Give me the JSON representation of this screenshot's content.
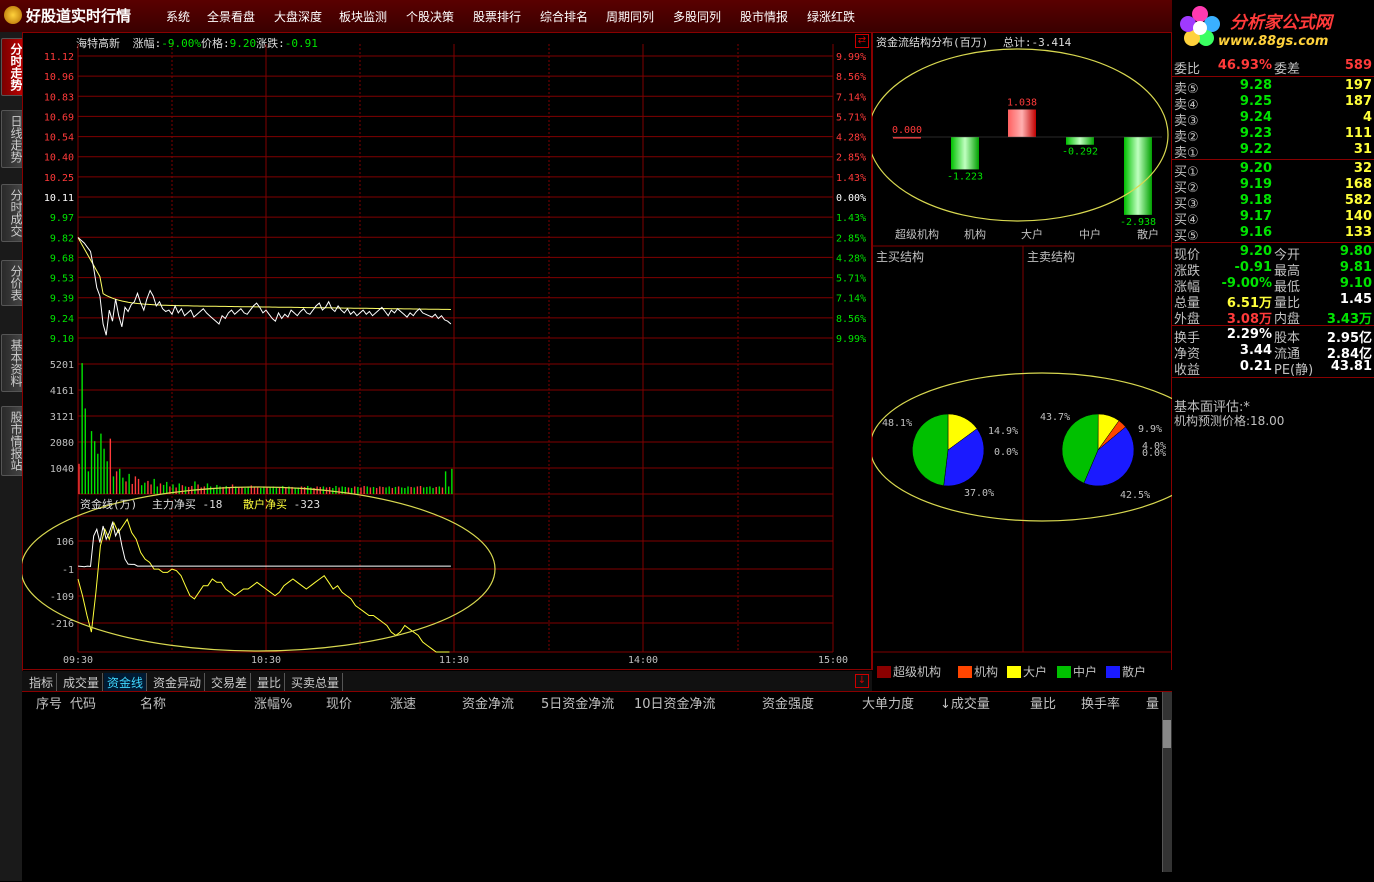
{
  "app": {
    "title": "好股道实时行情"
  },
  "menu": [
    "系统",
    "全景看盘",
    "大盘深度",
    "板块监测",
    "个股决策",
    "股票排行",
    "综合排名",
    "周期同列",
    "多股同列",
    "股市情报",
    "绿涨红跌"
  ],
  "brand": {
    "title": "分析家公式网",
    "url": "www.88gs.com"
  },
  "left_tabs": [
    "分时走势",
    "日线走势",
    "分时成交",
    "分价表",
    "基本资料",
    "股市情报站"
  ],
  "stock_header": {
    "name": "海特高新",
    "change_pct_label": "涨幅:",
    "change_pct": "-9.00%",
    "price_label": "价格:",
    "price": "9.20",
    "change_label": "涨跌:",
    "change": "-0.91"
  },
  "price_axis": {
    "left": [
      "11.12",
      "10.96",
      "10.83",
      "10.69",
      "10.54",
      "10.40",
      "10.25",
      "10.11",
      "9.97",
      "9.82",
      "9.68",
      "9.53",
      "9.39",
      "9.24",
      "9.10"
    ],
    "right": [
      "9.99%",
      "8.56%",
      "7.14%",
      "5.71%",
      "4.28%",
      "2.85%",
      "1.43%",
      "0.00%",
      "1.43%",
      "2.85%",
      "4.28%",
      "5.71%",
      "7.14%",
      "8.56%",
      "9.99%"
    ]
  },
  "volume_axis": [
    "5201",
    "4161",
    "3121",
    "2080",
    "1040"
  ],
  "fund_header": {
    "title": "资金线(万)",
    "main_label": "主力净买",
    "main_value": "-18",
    "retail_label": "散户净买",
    "retail_value": "-323"
  },
  "fund_axis": [
    "106",
    "-1",
    "-109",
    "-216"
  ],
  "time_axis": [
    "09:30",
    "10:30",
    "11:30",
    "14:00",
    "15:00"
  ],
  "bottom_tabs": [
    "指标",
    "成交量",
    "资金线",
    "资金异动",
    "交易差",
    "量比",
    "买卖总量"
  ],
  "bottom_tab_active": "资金线",
  "table_headers": [
    "序号",
    "代码",
    "名称",
    "涨幅%",
    "现价",
    "涨速",
    "资金净流",
    "5日资金净流",
    "10日资金净流",
    "资金强度",
    "大单力度",
    "↓成交量",
    "量比",
    "换手率",
    "量"
  ],
  "flow_dist": {
    "title": "资金流结构分布(百万)",
    "total_label": "总计:",
    "total": "-3.414",
    "bars": [
      {
        "label": "超级机构",
        "value": 0.0,
        "text": "0.000"
      },
      {
        "label": "机构",
        "value": -1.223,
        "text": "-1.223"
      },
      {
        "label": "大户",
        "value": 1.038,
        "text": "1.038"
      },
      {
        "label": "中户",
        "value": -0.292,
        "text": "-0.292"
      },
      {
        "label": "散户",
        "value": -2.938,
        "text": "-2.938"
      }
    ]
  },
  "buy_struct": {
    "title": "主买结构",
    "labels": [
      "48.1%",
      "14.9%",
      "0.0%",
      "37.0%"
    ]
  },
  "sell_struct": {
    "title": "主卖结构",
    "labels": [
      "43.7%",
      "9.9%",
      "4.0%",
      "0.0%",
      "42.5%"
    ]
  },
  "legend": [
    {
      "name": "超级机构",
      "color": "#8b0000"
    },
    {
      "name": "机构",
      "color": "#ff4500"
    },
    {
      "name": "大户",
      "color": "#ffff00"
    },
    {
      "name": "中户",
      "color": "#00c000"
    },
    {
      "name": "散户",
      "color": "#1a1aff"
    }
  ],
  "quote": {
    "weibi_label": "委比",
    "weibi": "46.93%",
    "weicha_label": "委差",
    "weicha": "589",
    "sell": [
      {
        "label": "卖⑤",
        "price": "9.28",
        "vol": "197"
      },
      {
        "label": "卖④",
        "price": "9.25",
        "vol": "187"
      },
      {
        "label": "卖③",
        "price": "9.24",
        "vol": "4"
      },
      {
        "label": "卖②",
        "price": "9.23",
        "vol": "111"
      },
      {
        "label": "卖①",
        "price": "9.22",
        "vol": "31"
      }
    ],
    "buy": [
      {
        "label": "买①",
        "price": "9.20",
        "vol": "32"
      },
      {
        "label": "买②",
        "price": "9.19",
        "vol": "168"
      },
      {
        "label": "买③",
        "price": "9.18",
        "vol": "582"
      },
      {
        "label": "买④",
        "price": "9.17",
        "vol": "140"
      },
      {
        "label": "买⑤",
        "price": "9.16",
        "vol": "133"
      }
    ],
    "stats": [
      {
        "l1": "现价",
        "v1": "9.20",
        "c1": "green",
        "l2": "今开",
        "v2": "9.80",
        "c2": "green"
      },
      {
        "l1": "涨跌",
        "v1": "-0.91",
        "c1": "green",
        "l2": "最高",
        "v2": "9.81",
        "c2": "green"
      },
      {
        "l1": "涨幅",
        "v1": "-9.00%",
        "c1": "green",
        "l2": "最低",
        "v2": "9.10",
        "c2": "green"
      },
      {
        "l1": "总量",
        "v1": "6.51万",
        "c1": "yellow",
        "l2": "量比",
        "v2": "1.45",
        "c2": "white"
      },
      {
        "l1": "外盘",
        "v1": "3.08万",
        "c1": "red",
        "l2": "内盘",
        "v2": "3.43万",
        "c2": "green"
      }
    ],
    "stats2": [
      {
        "l1": "换手",
        "v1": "2.29%",
        "l2": "股本",
        "v2": "2.95亿"
      },
      {
        "l1": "净资",
        "v1": "3.44",
        "l2": "流通",
        "v2": "2.84亿"
      },
      {
        "l1": "收益",
        "v1": "0.21",
        "l2": "PE(静)",
        "v2": "43.81"
      }
    ],
    "eval_label": "基本面评估:*",
    "target_label": "机构预测价格:",
    "target_value": "18.00"
  },
  "colors": {
    "up": "#ff3a3a",
    "down": "#00e400",
    "grid": "#800000",
    "price_line": "#ffffff",
    "avg_line": "#ffff66"
  }
}
